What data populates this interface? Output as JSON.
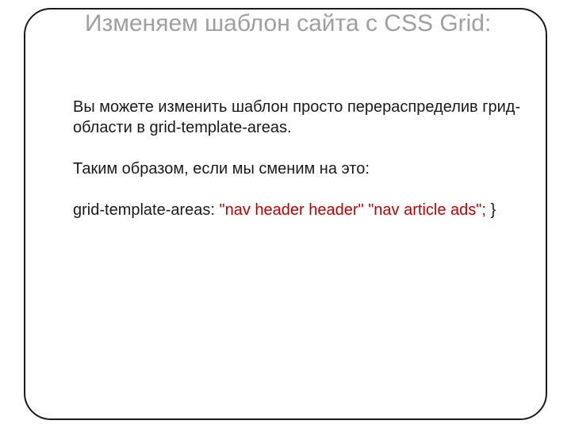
{
  "title": "Изменяем шаблон сайта с CSS Grid:",
  "paragraph1": "Вы можете изменить шаблон просто перераспределив грид-области в grid-template-areas.",
  "paragraph2": "Таким образом, если мы сменим на это:",
  "code": {
    "property": "grid-template-areas:",
    "value": "\"nav header header\" \"nav article ads\";",
    "close": "}"
  }
}
